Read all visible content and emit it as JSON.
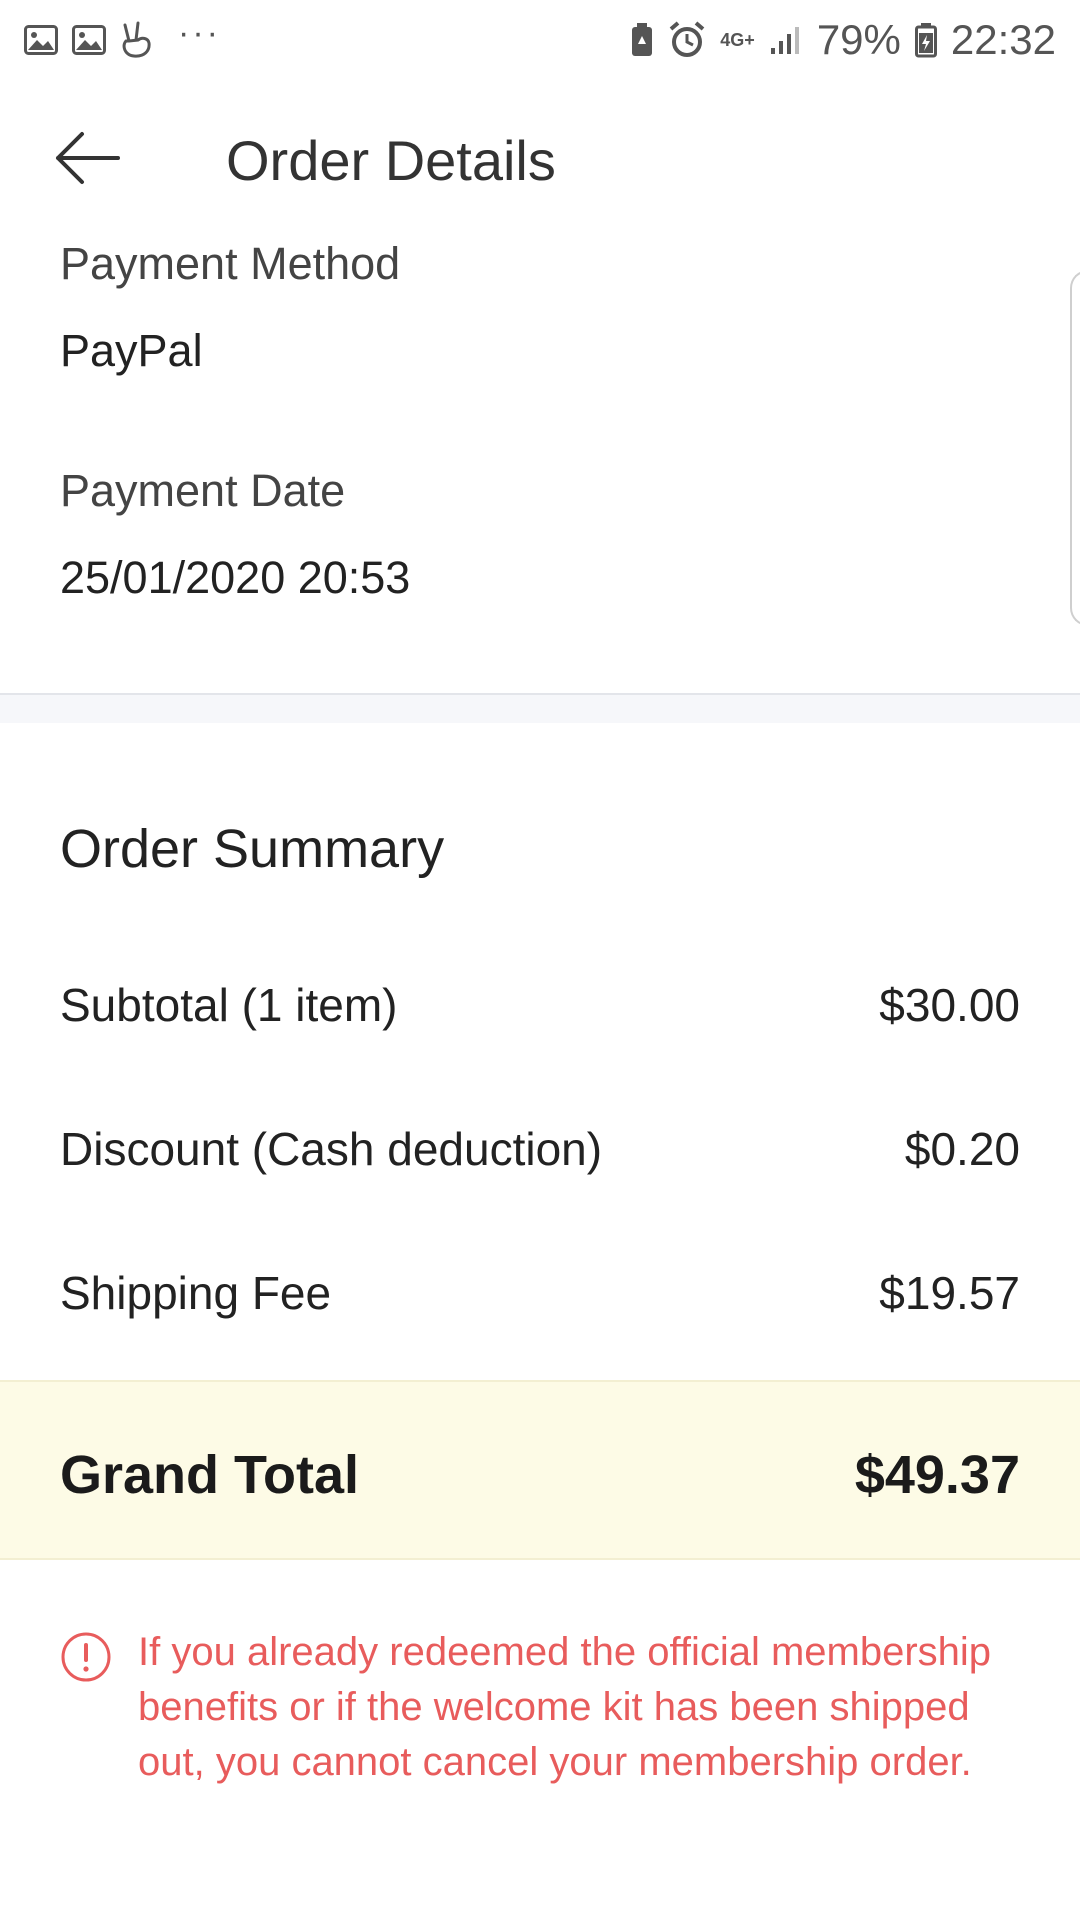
{
  "status_bar": {
    "icons_left": [
      "image-icon",
      "image-icon",
      "victory-hand-icon"
    ],
    "more": "···",
    "network": "4G+",
    "battery": "79%",
    "time": "22:32"
  },
  "header": {
    "title": "Order Details",
    "back_icon": "arrow-left-icon"
  },
  "payment": {
    "method_label": "Payment Method",
    "method_value": "PayPal",
    "date_label": "Payment Date",
    "date_value": "25/01/2020 20:53"
  },
  "order_summary": {
    "title": "Order Summary",
    "rows": [
      {
        "label": "Subtotal (1 item)",
        "value": "$30.00"
      },
      {
        "label": "Discount (Cash deduction)",
        "value": "$0.20"
      },
      {
        "label": "Shipping Fee",
        "value": "$19.57"
      }
    ],
    "grand_total_label": "Grand Total",
    "grand_total_value": "$49.37"
  },
  "warning": {
    "icon": "exclamation-circle-icon",
    "text": "If you already redeemed the official membership benefits or if the welcome kit has been shipped out, you cannot cancel your membership order."
  },
  "colors": {
    "warning": "#e85c5c",
    "grand_total_bg": "#fdfbe6",
    "separator": "#f6f7fa"
  }
}
